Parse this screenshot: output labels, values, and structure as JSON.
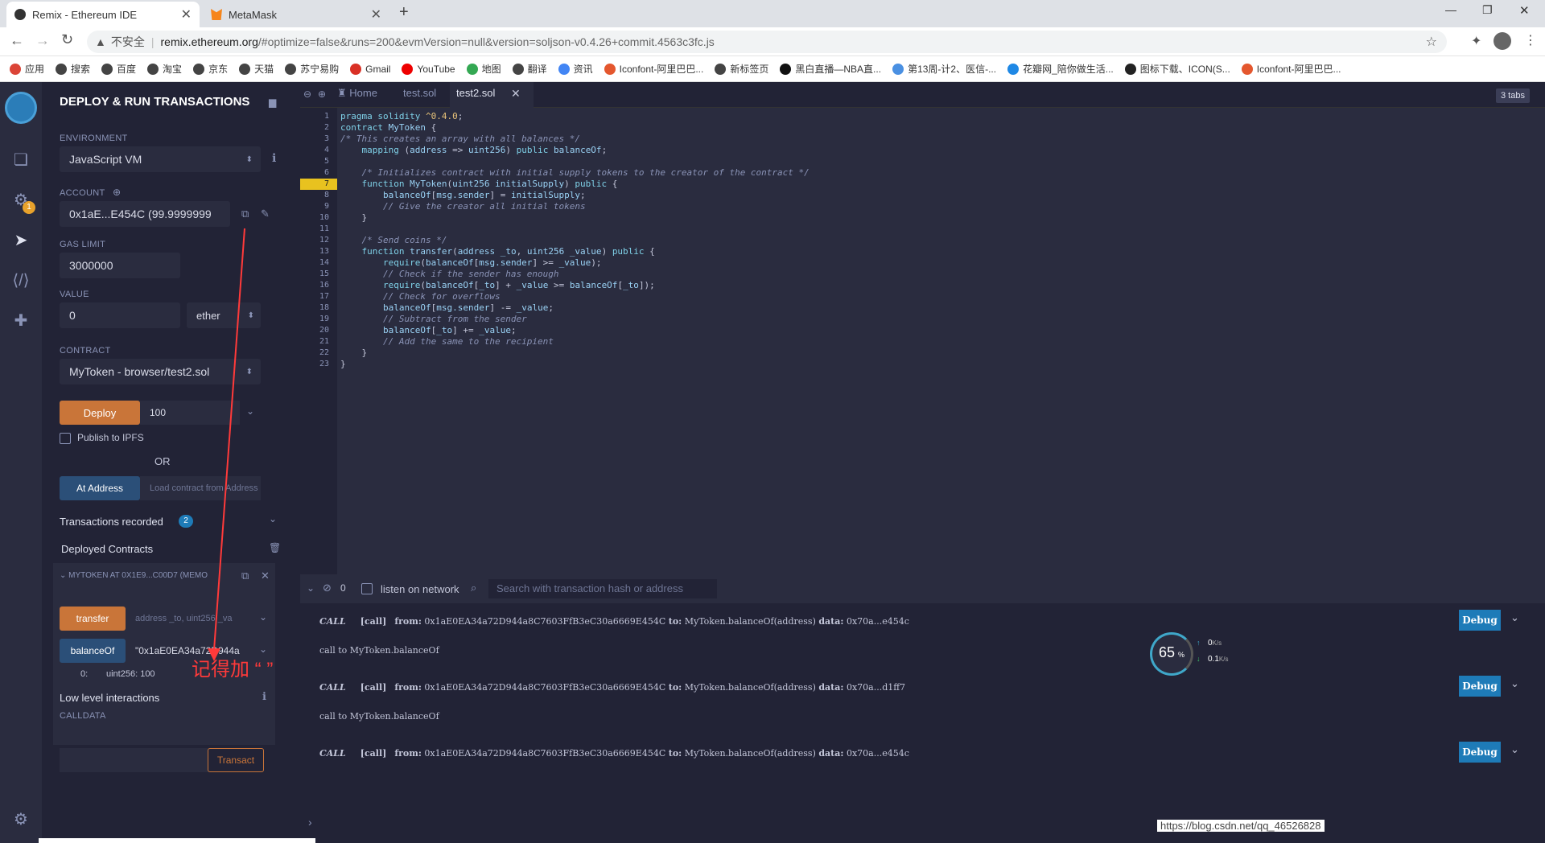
{
  "browser": {
    "tabs": [
      {
        "label": "Remix - Ethereum IDE",
        "active": true
      },
      {
        "label": "MetaMask",
        "active": false
      }
    ],
    "new_tab": "+",
    "security": "不安全",
    "url_host": "remix.ethereum.org",
    "url_rest": "/#optimize=false&runs=200&evmVersion=null&version=soljson-v0.4.26+commit.4563c3fc.js",
    "bookmarks": [
      {
        "label": "应用",
        "color": "#db4437"
      },
      {
        "label": "搜索",
        "color": "#444"
      },
      {
        "label": "百度",
        "color": "#444"
      },
      {
        "label": "淘宝",
        "color": "#444"
      },
      {
        "label": "京东",
        "color": "#444"
      },
      {
        "label": "天猫",
        "color": "#444"
      },
      {
        "label": "苏宁易购",
        "color": "#444"
      },
      {
        "label": "Gmail",
        "color": "#d93025"
      },
      {
        "label": "YouTube",
        "color": "#e00"
      },
      {
        "label": "地图",
        "color": "#34a853"
      },
      {
        "label": "翻译",
        "color": "#444"
      },
      {
        "label": "资讯",
        "color": "#4285f4"
      },
      {
        "label": "Iconfont-阿里巴巴...",
        "color": "#e4572e"
      },
      {
        "label": "新标签页",
        "color": "#444"
      },
      {
        "label": "黑白直播—NBA直...",
        "color": "#111"
      },
      {
        "label": "第13周-计2、医信-...",
        "color": "#4a90e2"
      },
      {
        "label": "花瓣网_陪你做生活...",
        "color": "#1e88e5"
      },
      {
        "label": "图标下载、ICON(S...",
        "color": "#222"
      },
      {
        "label": "Iconfont-阿里巴巴...",
        "color": "#e4572e"
      }
    ]
  },
  "sidebar": {
    "title": "DEPLOY & RUN TRANSACTIONS",
    "environment_label": "ENVIRONMENT",
    "environment_value": "JavaScript VM",
    "account_label": "ACCOUNT",
    "account_value": "0x1aE...E454C (99.9999999",
    "gas_label": "GAS LIMIT",
    "gas_value": "3000000",
    "value_label": "VALUE",
    "value_amount": "0",
    "value_unit": "ether",
    "contract_label": "CONTRACT",
    "contract_value": "MyToken - browser/test2.sol",
    "deploy_label": "Deploy",
    "deploy_arg": "100",
    "publish_label": "Publish to IPFS",
    "or_label": "OR",
    "at_address_label": "At Address",
    "at_address_placeholder": "Load contract from Address",
    "tx_recorded_label": "Transactions recorded",
    "tx_recorded_count": "2",
    "deployed_label": "Deployed Contracts",
    "instance_label": "MYTOKEN AT 0X1E9...C00D7 (MEMO",
    "transfer_label": "transfer",
    "transfer_placeholder": "address _to, uint256 _va",
    "balance_label": "balanceOf",
    "balance_value": "\"0x1aE0EA34a72D944a",
    "result_index": "0:",
    "result_value": "uint256: 100",
    "annotation": "记得加 “ ”",
    "low_level_label": "Low level interactions",
    "calldata_label": "CALLDATA",
    "transact_label": "Transact",
    "plugin_badge": "1"
  },
  "editor": {
    "tabs": [
      "Home",
      "test.sol",
      "test2.sol"
    ],
    "tab_count": "3 tabs",
    "lines": [
      "pragma solidity ^0.4.0;",
      "contract MyToken {",
      "/* This creates an array with all balances */",
      "    mapping (address => uint256) public balanceOf;",
      "",
      "    /* Initializes contract with initial supply tokens to the creator of the contract */",
      "    function MyToken(uint256 initialSupply) public {",
      "        balanceOf[msg.sender] = initialSupply;",
      "        // Give the creator all initial tokens",
      "    }",
      "",
      "    /* Send coins */",
      "    function transfer(address _to, uint256 _value) public {",
      "        require(balanceOf[msg.sender] >= _value);",
      "        // Check if the sender has enough",
      "        require(balanceOf[_to] + _value >= balanceOf[_to]);",
      "        // Check for overflows",
      "        balanceOf[msg.sender] -= _value;",
      "        // Subtract from the sender",
      "        balanceOf[_to] += _value;",
      "        // Add the same to the recipient",
      "    }",
      "}"
    ]
  },
  "terminal": {
    "pending": "0",
    "listen_label": "listen on network",
    "search_placeholder": "Search with transaction hash or address",
    "entries": [
      {
        "kind": "CALL",
        "tag": "[call]",
        "from": "0x1aE0EA34a72D944a8C7603FfB3eC30a6669E454C",
        "to": "MyToken.balanceOf(address)",
        "data": "0x70a...e454c",
        "note": "call to MyToken.balanceOf"
      },
      {
        "kind": "CALL",
        "tag": "[call]",
        "from": "0x1aE0EA34a72D944a8C7603FfB3eC30a6669E454C",
        "to": "MyToken.balanceOf(address)",
        "data": "0x70a...d1ff7",
        "note": "call to MyToken.balanceOf"
      },
      {
        "kind": "CALL",
        "tag": "[call]",
        "from": "0x1aE0EA34a72D944a8C7603FfB3eC30a6669E454C",
        "to": "MyToken.balanceOf(address)",
        "data": "0x70a...e454c",
        "note": ""
      }
    ],
    "debug_label": "Debug",
    "from_label": "from:",
    "to_label": "to:",
    "data_label": "data:"
  },
  "widget": {
    "percent": "65",
    "up": "0",
    "up_unit": "K/s",
    "down": "0.1",
    "down_unit": "K/s"
  },
  "watermark": "https://blog.csdn.net/qq_46526828"
}
